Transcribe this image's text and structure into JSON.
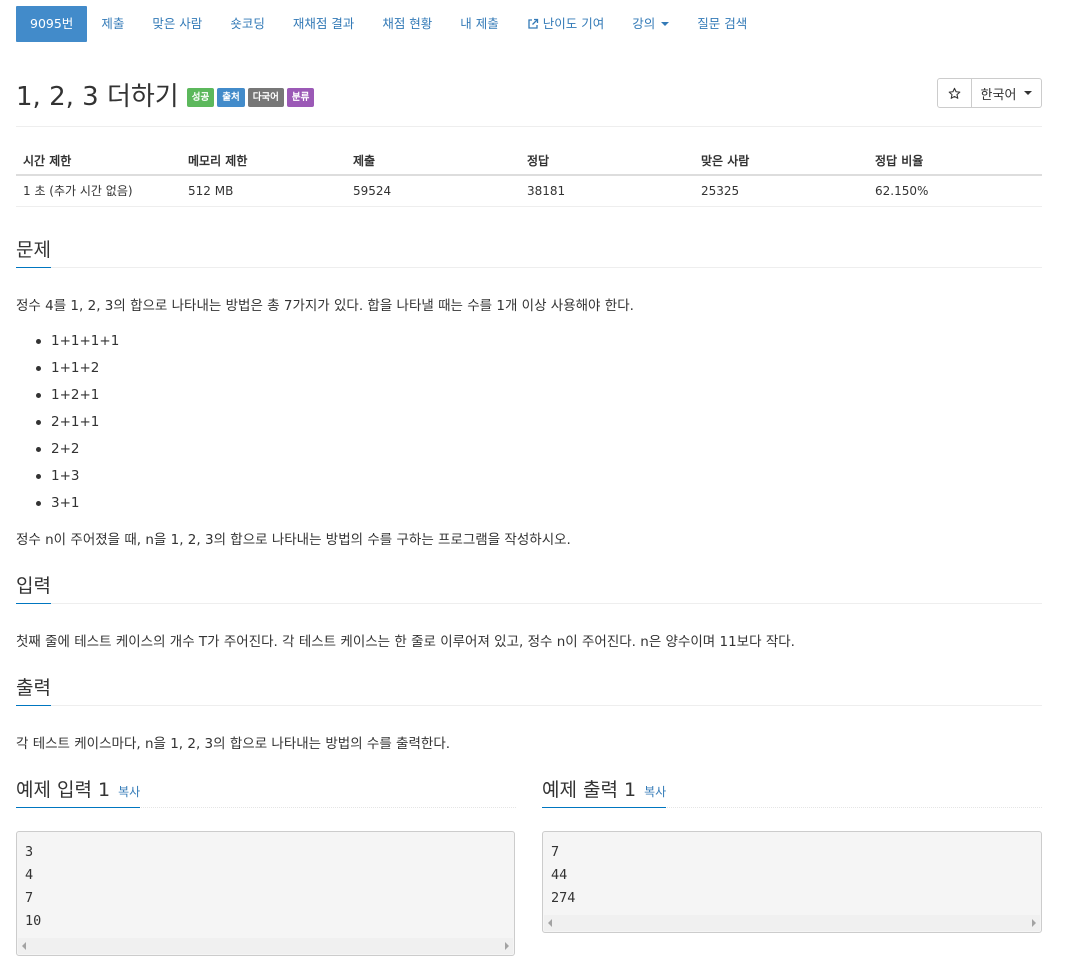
{
  "nav": {
    "tabs": [
      {
        "label": "9095번",
        "active": true
      },
      {
        "label": "제출"
      },
      {
        "label": "맞은 사람"
      },
      {
        "label": "숏코딩"
      },
      {
        "label": "재채점 결과"
      },
      {
        "label": "채점 현황"
      },
      {
        "label": "내 제출"
      },
      {
        "label": "난이도 기여",
        "icon": "external-link-icon"
      },
      {
        "label": "강의",
        "dropdown": true
      },
      {
        "label": "질문 검색"
      }
    ]
  },
  "problem": {
    "title": "1, 2, 3 더하기",
    "labels": [
      {
        "text": "성공",
        "color": "#5cb85c"
      },
      {
        "text": "출처",
        "color": "#428bca"
      },
      {
        "text": "다국어",
        "color": "#777777"
      },
      {
        "text": "분류",
        "color": "#9b59b6"
      }
    ],
    "star_icon": "star-outline-icon",
    "language": "한국어"
  },
  "info": {
    "headers": [
      "시간 제한",
      "메모리 제한",
      "제출",
      "정답",
      "맞은 사람",
      "정답 비율"
    ],
    "values": [
      "1 초 (추가 시간 없음)",
      "512 MB",
      "59524",
      "38181",
      "25325",
      "62.150%"
    ]
  },
  "sections": {
    "description": {
      "title": "문제",
      "intro": "정수 4를 1, 2, 3의 합으로 나타내는 방법은 총 7가지가 있다. 합을 나타낼 때는 수를 1개 이상 사용해야 한다.",
      "items": [
        "1+1+1+1",
        "1+1+2",
        "1+2+1",
        "2+1+1",
        "2+2",
        "1+3",
        "3+1"
      ],
      "outro": "정수 n이 주어졌을 때, n을 1, 2, 3의 합으로 나타내는 방법의 수를 구하는 프로그램을 작성하시오."
    },
    "input": {
      "title": "입력",
      "text": "첫째 줄에 테스트 케이스의 개수 T가 주어진다. 각 테스트 케이스는 한 줄로 이루어져 있고, 정수 n이 주어진다. n은 양수이며 11보다 작다."
    },
    "output": {
      "title": "출력",
      "text": "각 테스트 케이스마다, n을 1, 2, 3의 합으로 나타내는 방법의 수를 출력한다."
    }
  },
  "samples": {
    "input_title": "예제 입력 1",
    "output_title": "예제 출력 1",
    "copy_label": "복사",
    "input_lines": [
      "3",
      "4",
      "7",
      "10"
    ],
    "output_lines": [
      "7",
      "44",
      "274"
    ]
  }
}
